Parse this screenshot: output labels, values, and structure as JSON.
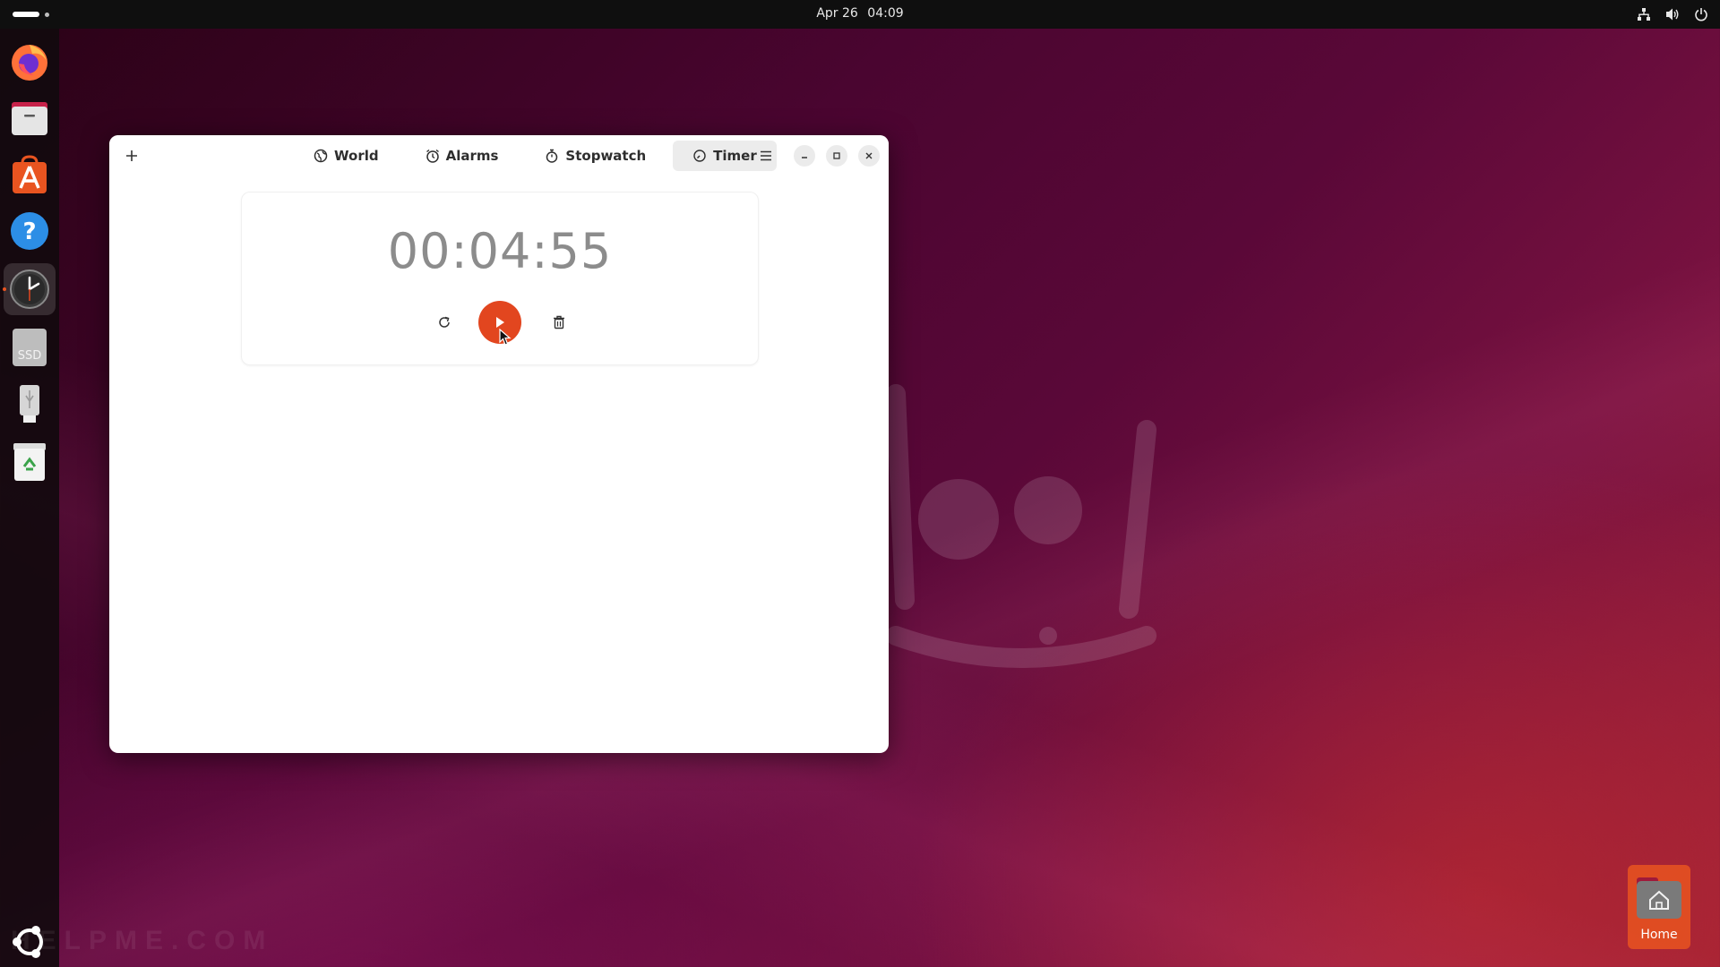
{
  "topbar": {
    "date": "Apr 26",
    "time": "04:09"
  },
  "dock": {
    "items": [
      {
        "name": "firefox"
      },
      {
        "name": "files"
      },
      {
        "name": "app-center"
      },
      {
        "name": "help"
      },
      {
        "name": "clocks",
        "running": true
      },
      {
        "name": "ssd-drive",
        "label": "SSD"
      },
      {
        "name": "usb-drive"
      },
      {
        "name": "trash"
      },
      {
        "name": "show-apps"
      }
    ]
  },
  "window": {
    "tabs": [
      {
        "label": "World",
        "icon": "globe-icon"
      },
      {
        "label": "Alarms",
        "icon": "alarm-icon"
      },
      {
        "label": "Stopwatch",
        "icon": "stopwatch-icon"
      },
      {
        "label": "Timer",
        "icon": "timer-icon",
        "selected": true
      }
    ],
    "timer": {
      "display": "00:04:55"
    }
  },
  "desktop": {
    "home_label": "Home"
  },
  "watermark": "HELPME.COM",
  "colors": {
    "accent": "#e2461f",
    "topbar": "#0f0f0f"
  }
}
